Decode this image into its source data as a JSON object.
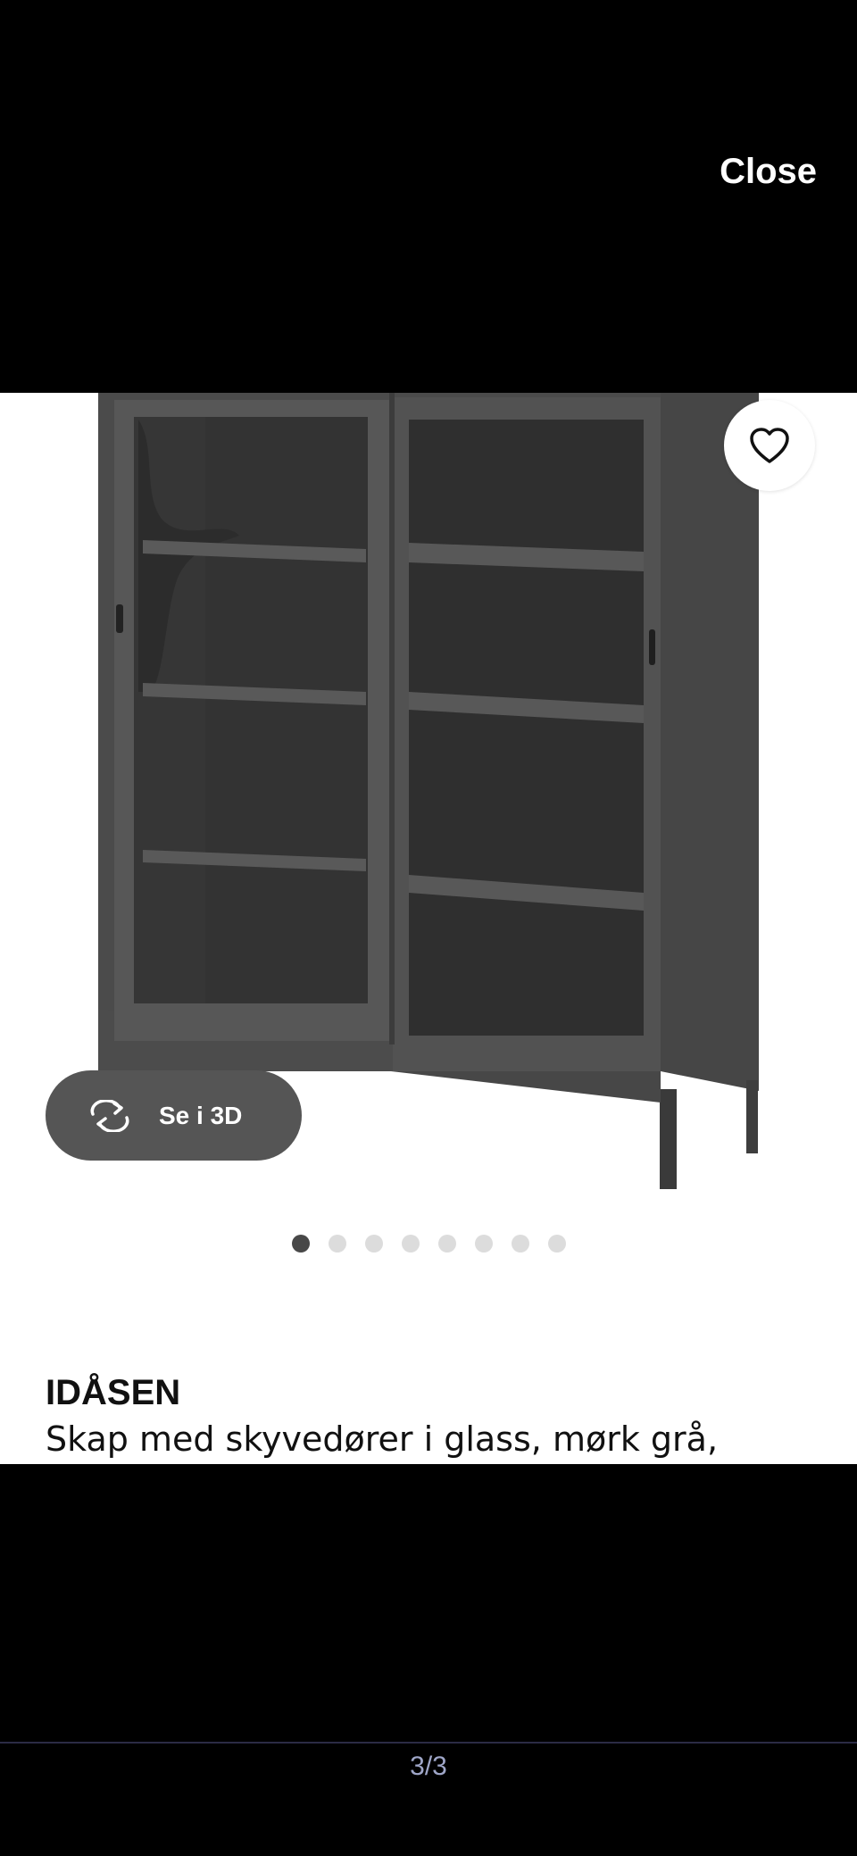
{
  "viewer": {
    "close_label": "Close",
    "page_counter": "3/3"
  },
  "product": {
    "name": "IDÅSEN",
    "description": "Skap med skyvedører i glass, mørk grå,",
    "view_3d_label": "Se i 3D",
    "favorite_icon": "heart-icon",
    "rotate_icon": "rotate-3d-icon"
  },
  "carousel": {
    "total": 8,
    "active_index": 0
  },
  "colors": {
    "background": "#000000",
    "card": "#ffffff",
    "cabinet": "#4a4a4a",
    "button_3d": "#555555",
    "dot_active": "#484848",
    "dot_inactive": "#dcdcdc",
    "counter_text": "#9fa6c8"
  }
}
